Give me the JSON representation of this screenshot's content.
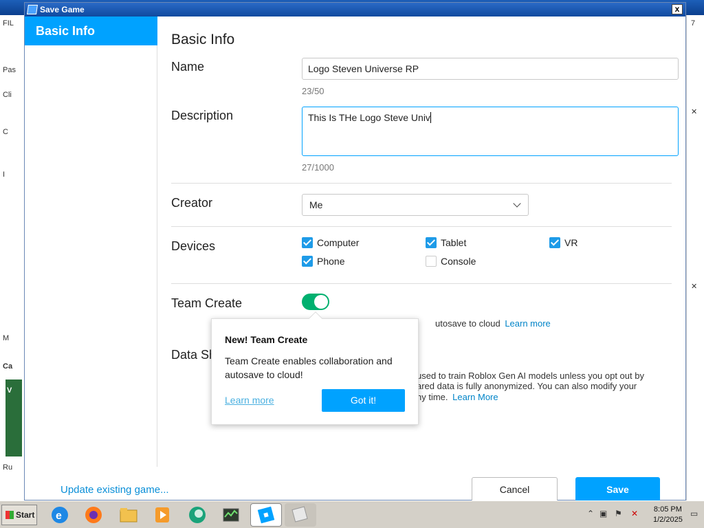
{
  "dialog": {
    "title": "Save Game",
    "close_label": "x"
  },
  "sidebar": {
    "items": [
      {
        "label": "Basic Info",
        "selected": true
      }
    ]
  },
  "main": {
    "section_title": "Basic Info",
    "name": {
      "label": "Name",
      "value": "Logo Steven Universe RP",
      "counter": "23/50"
    },
    "description": {
      "label": "Description",
      "value": "This Is THe Logo Steve Univ",
      "counter": "27/1000"
    },
    "creator": {
      "label": "Creator",
      "selected": "Me"
    },
    "devices": {
      "label": "Devices",
      "items": [
        {
          "label": "Computer",
          "checked": true
        },
        {
          "label": "Tablet",
          "checked": true
        },
        {
          "label": "VR",
          "checked": true
        },
        {
          "label": "Phone",
          "checked": true
        },
        {
          "label": "Console",
          "checked": false
        }
      ]
    },
    "team_create": {
      "label": "Team Create",
      "enabled": true,
      "description_tail": "utosave to cloud",
      "learn_more": "Learn more"
    },
    "data_sharing": {
      "label": "Data Sh",
      "line1": "used to train Roblox Gen AI models unless you opt out by",
      "line2": "ared data is fully anonymized. You can also modify your",
      "line3": "ny time.",
      "learn_more": "Learn More"
    }
  },
  "footer": {
    "update_link": "Update existing game...",
    "cancel_label": "Cancel",
    "save_label": "Save"
  },
  "popover": {
    "title": "New! Team Create",
    "body": "Team Create enables collaboration and autosave to cloud!",
    "learn_more": "Learn more",
    "button_label": "Got it!"
  },
  "background": {
    "left_fragments": [
      "FIL",
      "Pas",
      "Cli",
      "C",
      "I",
      "M",
      "Ca",
      "V",
      "Ru"
    ],
    "right_fragments": [
      "7"
    ]
  },
  "taskbar": {
    "start_label": "Start",
    "time": "8:05 PM",
    "date": "1/2/2025",
    "icons": [
      "internet-explorer-icon",
      "firefox-icon",
      "file-explorer-icon",
      "media-player-icon",
      "browser-icon",
      "task-manager-icon",
      "roblox-studio-icon",
      "roblox-icon"
    ]
  },
  "colors": {
    "accent": "#00a2ff",
    "toggle_on": "#00b06f",
    "link": "#0084c8"
  }
}
